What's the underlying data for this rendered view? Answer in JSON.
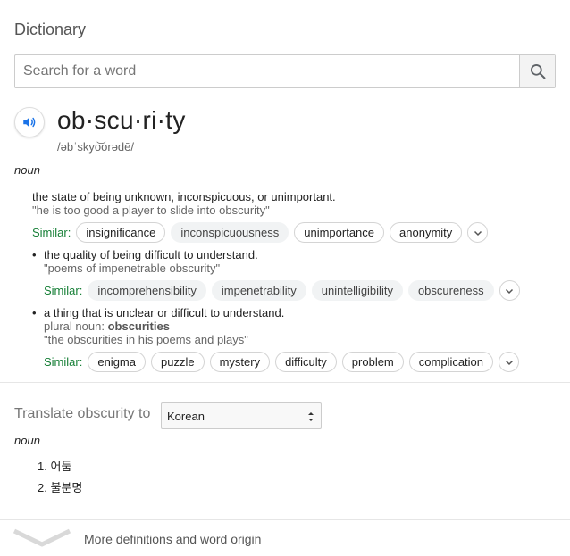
{
  "dictionary": {
    "title": "Dictionary",
    "search": {
      "placeholder": "Search for a word",
      "value": ""
    },
    "entry": {
      "headword": "ob·scu·ri·ty",
      "phonetic": "/əbˈskyo͝orədē/",
      "pos": "noun",
      "senses": [
        {
          "definition": "the state of being unknown, inconspicuous, or unimportant.",
          "example": "\"he is too good a player to slide into obscurity\"",
          "similar_label": "Similar:",
          "similar": [
            "insignificance",
            "inconspicuousness",
            "unimportance",
            "anonymity"
          ]
        },
        {
          "definition": "the quality of being difficult to understand.",
          "example": "\"poems of impenetrable obscurity\"",
          "similar_label": "Similar:",
          "similar": [
            "incomprehensibility",
            "impenetrability",
            "unintelligibility",
            "obscureness"
          ]
        },
        {
          "definition": "a thing that is unclear or difficult to understand.",
          "plural_label": "plural noun:",
          "plural": "obscurities",
          "example": "\"the obscurities in his poems and plays\"",
          "similar_label": "Similar:",
          "similar": [
            "enigma",
            "puzzle",
            "mystery",
            "difficulty",
            "problem",
            "complication"
          ]
        }
      ]
    },
    "translate": {
      "label": "Translate obscurity to",
      "language": "Korean",
      "pos": "noun",
      "items": [
        "1. 어둠",
        "2. 불분명"
      ]
    },
    "more_link": "More definitions and word origin",
    "icons": {
      "search": "search-icon",
      "speaker": "speaker-icon",
      "expand": "chevron-down-icon",
      "more": "chevron-down-icon"
    },
    "colors": {
      "similar_label": "#188038",
      "speaker": "#1a73e8",
      "example_text": "#666666"
    }
  }
}
